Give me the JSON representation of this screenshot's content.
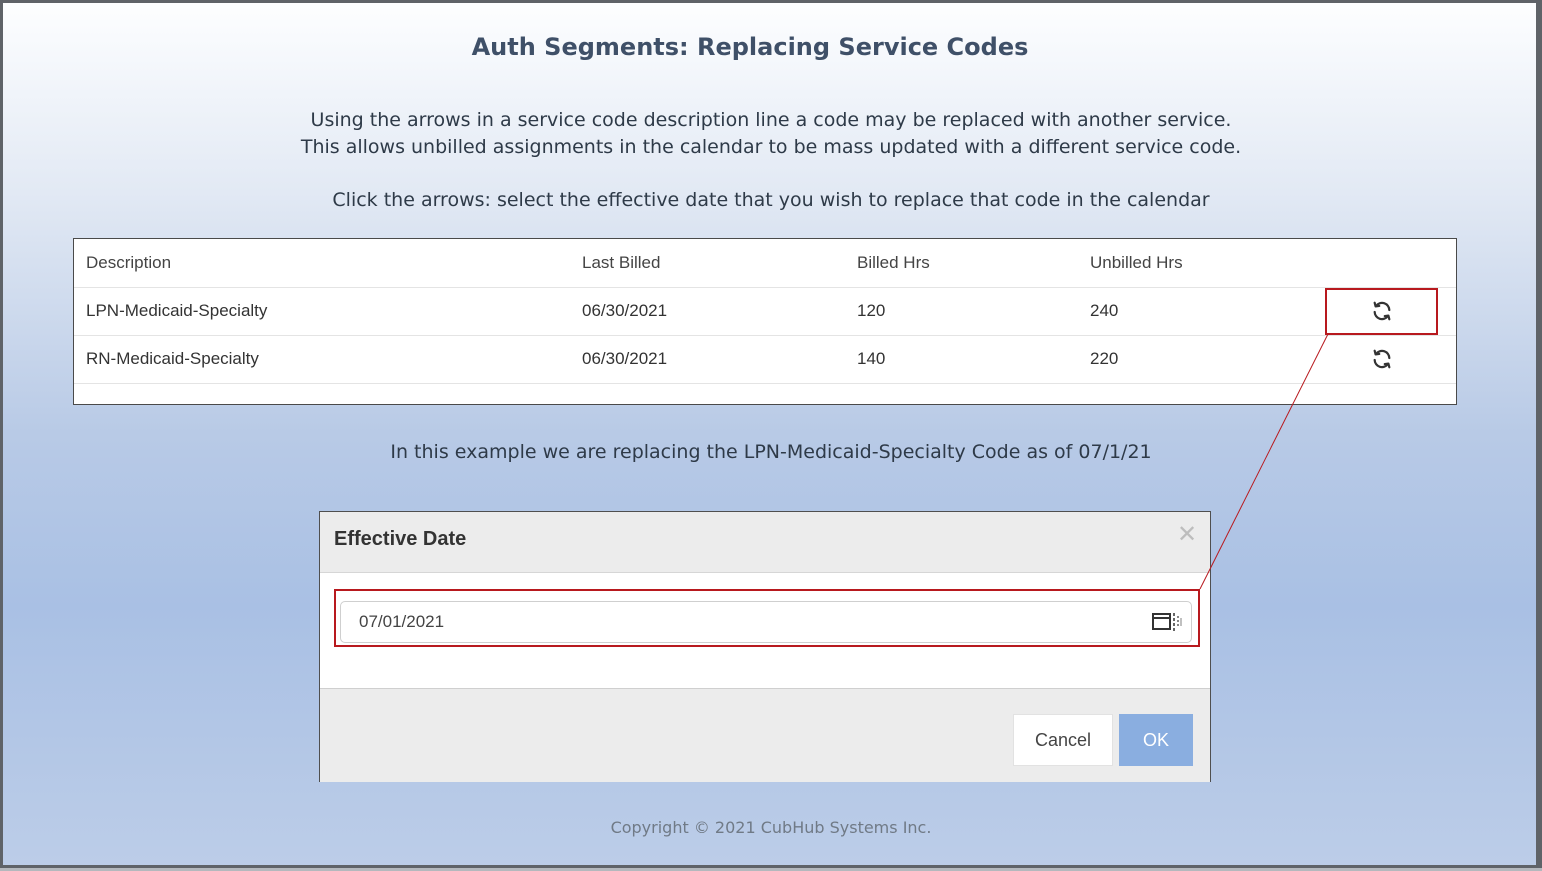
{
  "page": {
    "title": "Auth Segments: Replacing Service Codes",
    "intro_line1": "Using the arrows in a service code description line a code may be replaced with another service.",
    "intro_line2": "This allows unbilled assignments in the calendar to be mass updated with a different service code.",
    "instruction": "Click the arrows: select the effective date that you wish to replace that code in the calendar",
    "example": "In this example we are replacing the LPN-Medicaid-Specialty Code as of 07/1/21",
    "copyright": "Copyright © 2021 CubHub Systems Inc."
  },
  "table": {
    "headers": [
      "Description",
      "Last Billed",
      "Billed Hrs",
      "Unbilled Hrs"
    ],
    "rows": [
      {
        "description": "LPN-Medicaid-Specialty",
        "last_billed": "06/30/2021",
        "billed_hrs": "120",
        "unbilled_hrs": "240",
        "action_icon": "replace-arrows-icon"
      },
      {
        "description": "RN-Medicaid-Specialty",
        "last_billed": "06/30/2021",
        "billed_hrs": "140",
        "unbilled_hrs": "220",
        "action_icon": "replace-arrows-icon"
      }
    ]
  },
  "modal": {
    "title": "Effective Date",
    "close_icon": "close-icon",
    "date_value": "07/01/2021",
    "calendar_icon": "calendar-icon",
    "cancel_label": "Cancel",
    "ok_label": "OK"
  },
  "colors": {
    "highlight": "#b8191e",
    "ok_button": "#8aaee0",
    "title_text": "#3f5068"
  }
}
